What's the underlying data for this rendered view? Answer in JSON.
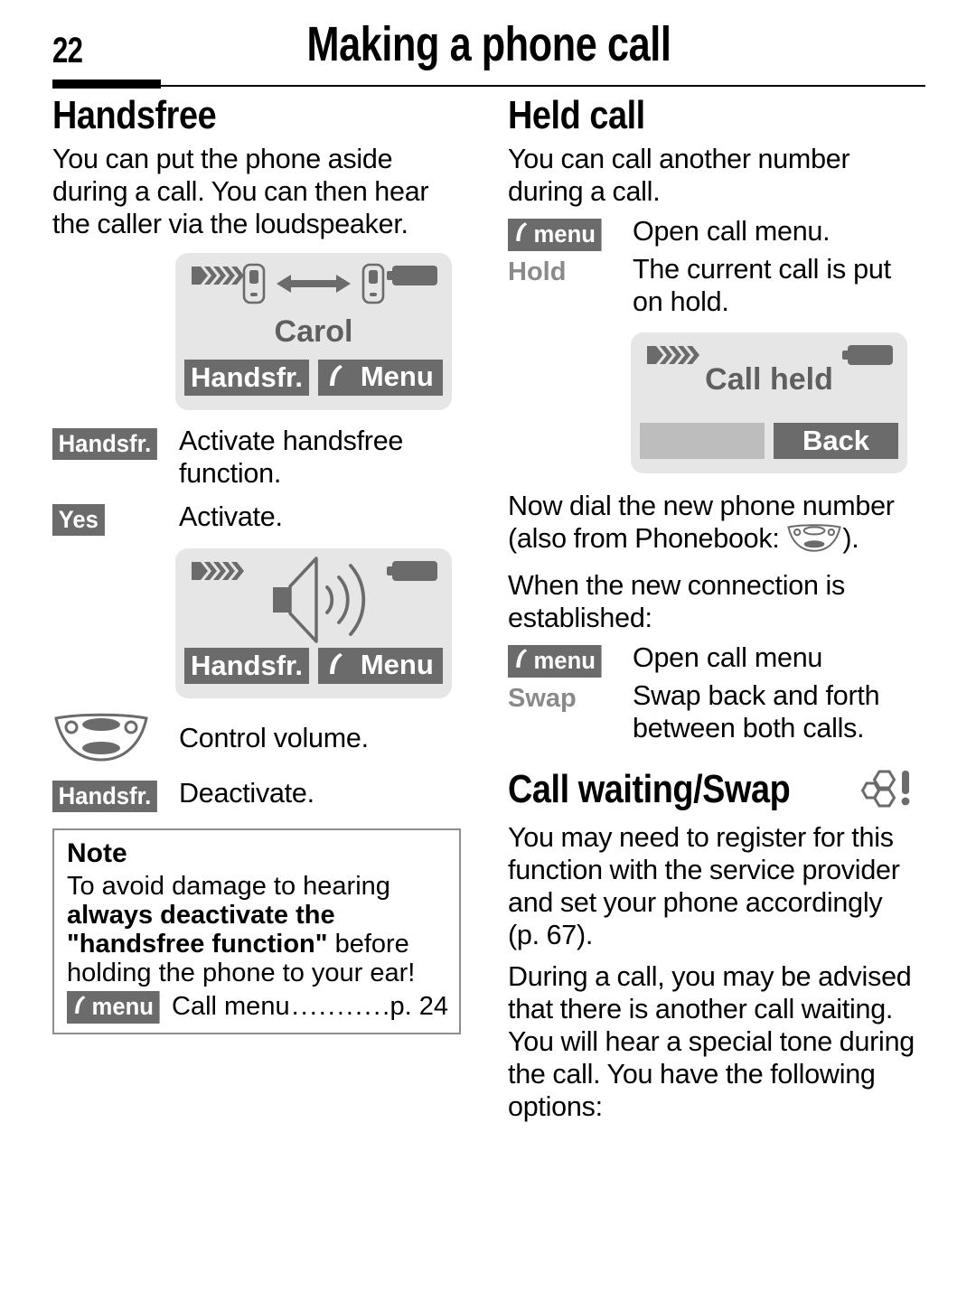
{
  "header": {
    "page_number": "22",
    "title": "Making a phone call"
  },
  "left_column": {
    "heading": "Handsfree",
    "intro": "You can put the phone aside during a call. You can then hear the caller via the loudspeaker.",
    "screen_call": {
      "contact_name": "Carol",
      "softkey_left": "Handsfr.",
      "softkey_right": "Menu",
      "softkey_right_icon": "phone-handset-icon",
      "signal_icon": "signal-strength-icon",
      "battery_icon": "battery-icon",
      "center_icon": "two-phones-connected-icon"
    },
    "steps": [
      {
        "key": "Handsfr.",
        "key_type": "chip",
        "desc": "Activate handsfree function."
      },
      {
        "key": "Yes",
        "key_type": "chip",
        "desc": "Activate."
      }
    ],
    "screen_speaker": {
      "softkey_left": "Handsfr.",
      "softkey_right": "Menu",
      "softkey_right_icon": "phone-handset-icon",
      "signal_icon": "signal-strength-icon",
      "battery_icon": "battery-icon",
      "center_icon": "loudspeaker-icon"
    },
    "steps2": [
      {
        "key": "",
        "key_type": "nav-key-icon",
        "desc": "Control volume."
      },
      {
        "key": "Handsfr.",
        "key_type": "chip",
        "desc": "Deactivate."
      }
    ],
    "note": {
      "title": "Note",
      "text_part1": "To avoid damage to hearing ",
      "text_bold": "always deactivate the \"handsfree function\"",
      "text_part2": " before holding the phone to your ear!",
      "xref_chip": "menu",
      "xref_chip_icon": "phone-handset-icon",
      "xref_label": "Call menu",
      "xref_page": "p. 24"
    }
  },
  "right_column": {
    "heading": "Held call",
    "intro": "You can call another number during a call.",
    "steps": [
      {
        "key": "menu",
        "key_type": "chip",
        "key_icon": "phone-handset-icon",
        "desc": "Open call menu."
      },
      {
        "key": "Hold",
        "key_type": "greykey",
        "desc": "The current call is put on hold."
      }
    ],
    "screen_held": {
      "status_text": "Call held",
      "softkey_left": "",
      "softkey_right": "Back",
      "signal_icon": "signal-strength-icon",
      "battery_icon": "battery-icon"
    },
    "para_dial_a": "Now dial the new phone number (also from Phonebook: ",
    "para_dial_icon": "nav-key-icon",
    "para_dial_b": ").",
    "para_established": "When the new connection is established:",
    "steps2": [
      {
        "key": "menu",
        "key_type": "chip",
        "key_icon": "phone-handset-icon",
        "desc": "Open call menu"
      },
      {
        "key": "Swap",
        "key_type": "greykey",
        "desc": "Swap back and forth between both calls."
      }
    ],
    "heading2": "Call waiting/Swap",
    "heading2_icon": "operator-dependent-icon",
    "para_register": "You may need to register for this function with the service provider and set your phone accordingly (p. 67).",
    "para_during": "During a call, you may be advised that there is another call waiting. You will hear a special tone during the call. You have the following options:"
  },
  "colors": {
    "screen_bg": "#e6e6e6",
    "softkey_dark": "#6b6b6b",
    "softkey_empty": "#bdbdbd",
    "grey_key_text": "#8a8a8a",
    "screen_label": "#5f5f5f",
    "note_border": "#8d8d8d"
  }
}
